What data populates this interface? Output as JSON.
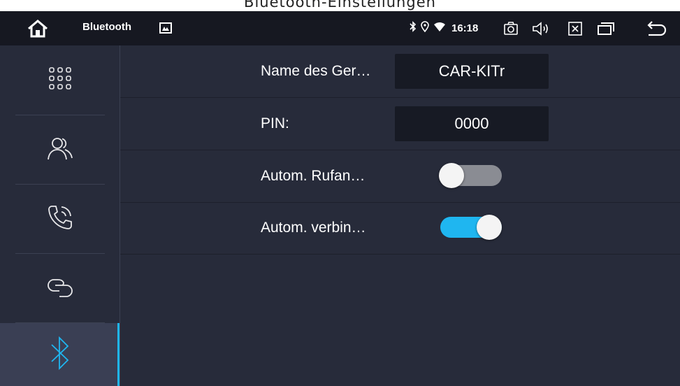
{
  "caption": "Bluetooth-Einstellungen",
  "statusbar": {
    "app_title": "Bluetooth",
    "time": "16:18",
    "icons": [
      "home-icon",
      "gallery-icon",
      "bluetooth-icon",
      "location-icon",
      "wifi-icon",
      "screenshot-icon",
      "volume-icon",
      "close-app-icon",
      "recent-apps-icon",
      "back-icon"
    ]
  },
  "sidebar": {
    "items": [
      {
        "icon": "apps-grid-icon",
        "active": false
      },
      {
        "icon": "contacts-icon",
        "active": false
      },
      {
        "icon": "call-log-icon",
        "active": false
      },
      {
        "icon": "link-icon",
        "active": false
      },
      {
        "icon": "bluetooth-icon",
        "active": true
      }
    ]
  },
  "settings": {
    "device_name": {
      "label": "Name des Ger…",
      "value": "CAR-KITr"
    },
    "pin": {
      "label": "PIN:",
      "value": "0000"
    },
    "auto_answer": {
      "label": "Autom. Rufan…",
      "enabled": false
    },
    "auto_connect": {
      "label": "Autom. verbin…",
      "enabled": true
    }
  },
  "colors": {
    "accent": "#1fb6f0",
    "background": "#272b3a",
    "statusbar": "#161821",
    "toggle_off": "#8a8c93"
  }
}
